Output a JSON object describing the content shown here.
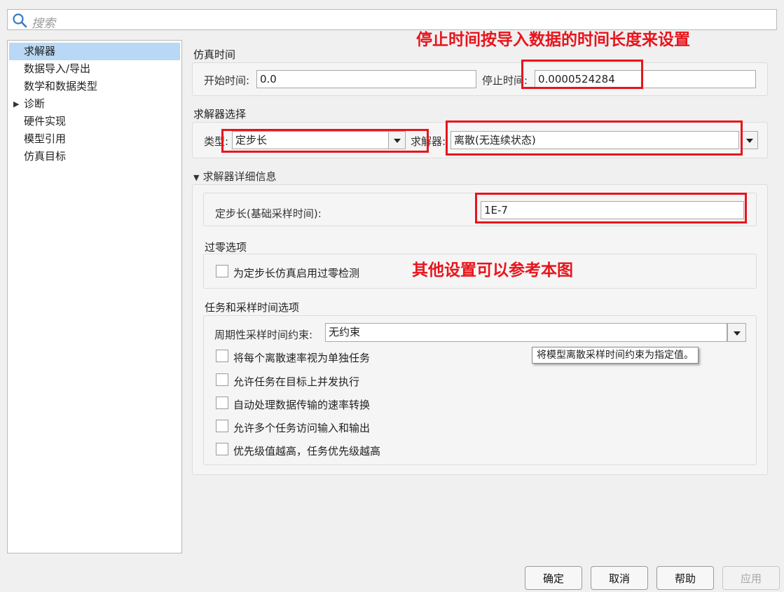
{
  "search": {
    "placeholder": "搜索"
  },
  "sidebar": {
    "items": [
      {
        "label": "求解器",
        "selected": true
      },
      {
        "label": "数据导入/导出"
      },
      {
        "label": "数学和数据类型"
      },
      {
        "label": "诊断",
        "expandable": true
      },
      {
        "label": "硬件实现"
      },
      {
        "label": "模型引用"
      },
      {
        "label": "仿真目标"
      }
    ]
  },
  "sim_time": {
    "title": "仿真时间",
    "start_label": "开始时间:",
    "start_value": "0.0",
    "stop_label": "停止时间:",
    "stop_value": "0.0000524284"
  },
  "solver_select": {
    "title": "求解器选择",
    "type_label": "类型:",
    "type_value": "定步长",
    "solver_label": "求解器:",
    "solver_value": "离散(无连续状态)"
  },
  "solver_details": {
    "title": "求解器详细信息",
    "step_label": "定步长(基础采样时间):",
    "step_value": "1E-7"
  },
  "zero_crossing": {
    "title": "过零选项",
    "checkbox_label": "为定步长仿真启用过零检测"
  },
  "tasks": {
    "title": "任务和采样时间选项",
    "constraint_label": "周期性采样时间约束:",
    "constraint_value": "无约束",
    "tooltip": "将模型离散采样时间约束为指定值。",
    "checkboxes": [
      "将每个离散速率视为单独任务",
      "允许任务在目标上并发执行",
      "自动处理数据传输的速率转换",
      "允许多个任务访问输入和输出",
      "优先级值越高，任务优先级越高"
    ]
  },
  "annotations": {
    "top": "停止时间按导入数据的时间长度来设置",
    "middle": "其他设置可以参考本图",
    "color": "#e8141c"
  },
  "buttons": {
    "ok": "确定",
    "cancel": "取消",
    "help": "帮助",
    "apply": "应用"
  },
  "colors": {
    "selection": "#b8d8f5",
    "annotation_red": "#e8141c"
  }
}
